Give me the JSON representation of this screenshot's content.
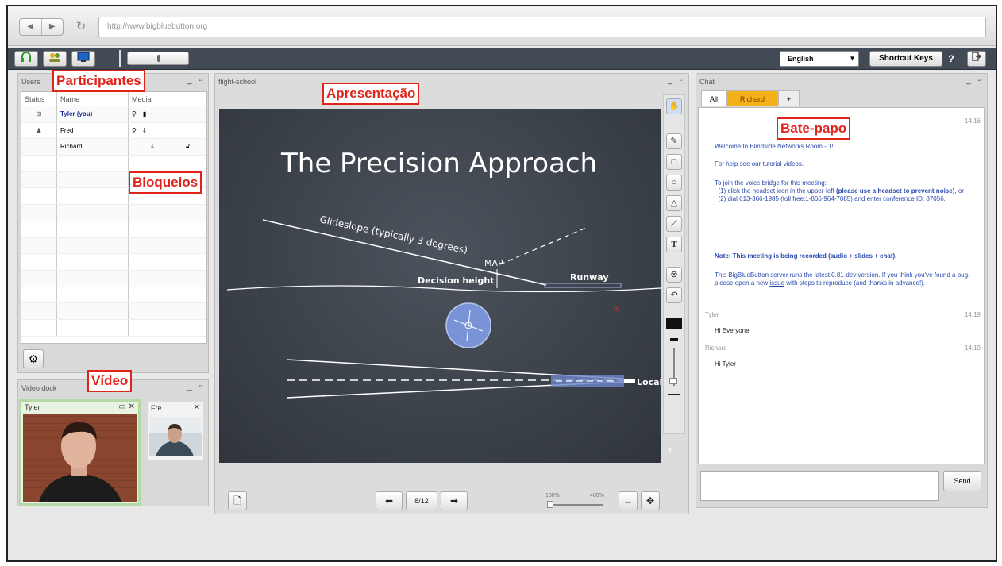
{
  "browser": {
    "url": "http://www.bigbluebutton.org"
  },
  "toolbar": {
    "language": "English",
    "shortcut_keys": "Shortcut Keys",
    "help": "?"
  },
  "users_panel": {
    "title": "Users",
    "columns": [
      "Status",
      "Name",
      "Media"
    ],
    "rows": [
      {
        "name": "Tyler (you)",
        "status": "presenter-icon",
        "media": [
          "webcam-icon",
          "mic-icon"
        ],
        "locked": false
      },
      {
        "name": "Fred",
        "status": "person-icon",
        "media": [
          "webcam-icon",
          "mic-off-icon"
        ],
        "locked": false
      },
      {
        "name": "Richard",
        "status": "",
        "media": [
          "mic-off-icon"
        ],
        "locked": true
      }
    ]
  },
  "video_dock": {
    "title": "Video dock",
    "cams": [
      {
        "name": "Tyler"
      },
      {
        "name": "Fre"
      }
    ]
  },
  "presentation": {
    "title": "flight-school",
    "slide": {
      "heading": "The Precision Approach",
      "labels": [
        "Glideslope (typically 3 degrees)",
        "MAP",
        "Decision height",
        "Runway",
        "Locali"
      ],
      "page_badge": "7"
    },
    "page_indicator": "8/12",
    "zoom_min": "100%",
    "zoom_max": "400%"
  },
  "chat": {
    "title": "Chat",
    "tabs": [
      "All",
      "Richard",
      "+"
    ],
    "messages": {
      "system_time": "14:16",
      "welcome": "Welcome to Blindside Networks Room - 1!",
      "help_prefix": "For help see our ",
      "help_link": "tutorial videos",
      "help_suffix": ".",
      "voice_intro": "To join the voice bridge for this meeting:",
      "voice_1a": "(1) click the headset icon in the upper-left ",
      "voice_1b": "(please use a headset to prevent noise)",
      "voice_1c": ", or",
      "voice_2": "(2) dial 613-366-1985 (toll free:1-866-964-7085) and enter conference ID: 87056.",
      "note": "Note: This meeting is being recorded (audio + slides + chat).",
      "server_a": "This BigBlueButton server runs the latest 0.81-dev version. If you think you've found a bug, please open a new ",
      "server_link": "issue",
      "server_b": " with steps to reproduce (and thanks in advance!).",
      "tyler_name": "Tyler",
      "tyler_time": "14:19",
      "tyler_msg": "Hi Everyone",
      "richard_name": "Richard",
      "richard_time": "14:19",
      "richard_msg": "Hi Tyler"
    },
    "send": "Send"
  },
  "annotations": {
    "participantes": "Participantes",
    "bloqueios": "Bloqueios",
    "video": "Vídeo",
    "apresentacao": "Apresentação",
    "bate_papo": "Bate-papo"
  },
  "colors": {
    "annotation": "#e2231a",
    "toolbar": "#424a55",
    "chat_text": "#2b4aad",
    "richard_tab": "#f3b21a"
  }
}
